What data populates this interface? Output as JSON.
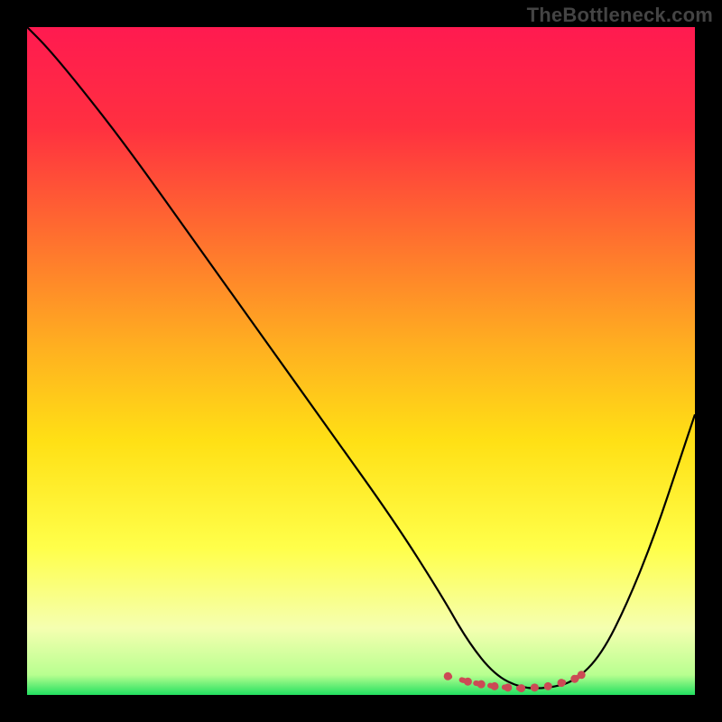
{
  "watermark": "TheBottleneck.com",
  "chart_data": {
    "type": "line",
    "title": "",
    "xlabel": "",
    "ylabel": "",
    "xlim": [
      0,
      100
    ],
    "ylim": [
      0,
      100
    ],
    "gradient_stops": [
      {
        "offset": 0,
        "color": "#ff1a50"
      },
      {
        "offset": 15,
        "color": "#ff3040"
      },
      {
        "offset": 30,
        "color": "#ff6a30"
      },
      {
        "offset": 48,
        "color": "#ffb020"
      },
      {
        "offset": 62,
        "color": "#ffe015"
      },
      {
        "offset": 78,
        "color": "#ffff4a"
      },
      {
        "offset": 90,
        "color": "#f5ffb0"
      },
      {
        "offset": 97,
        "color": "#b8ff90"
      },
      {
        "offset": 100,
        "color": "#22e060"
      }
    ],
    "series": [
      {
        "name": "curve",
        "color": "#000000",
        "x": [
          0,
          3,
          8,
          15,
          25,
          35,
          45,
          55,
          62,
          66,
          70,
          74,
          78,
          82,
          86,
          90,
          94,
          98,
          100
        ],
        "y": [
          100,
          97,
          91,
          82,
          68,
          54,
          40,
          26,
          15,
          8,
          3,
          1,
          1,
          2,
          6,
          14,
          24,
          36,
          42
        ]
      },
      {
        "name": "min-markers",
        "color": "#cc4a55",
        "style": "dots",
        "x": [
          63,
          66,
          68,
          70,
          72,
          74,
          76,
          78,
          80,
          82,
          83
        ],
        "y": [
          2.8,
          2.0,
          1.6,
          1.3,
          1.1,
          1.0,
          1.1,
          1.3,
          1.8,
          2.4,
          3.0
        ]
      }
    ]
  }
}
